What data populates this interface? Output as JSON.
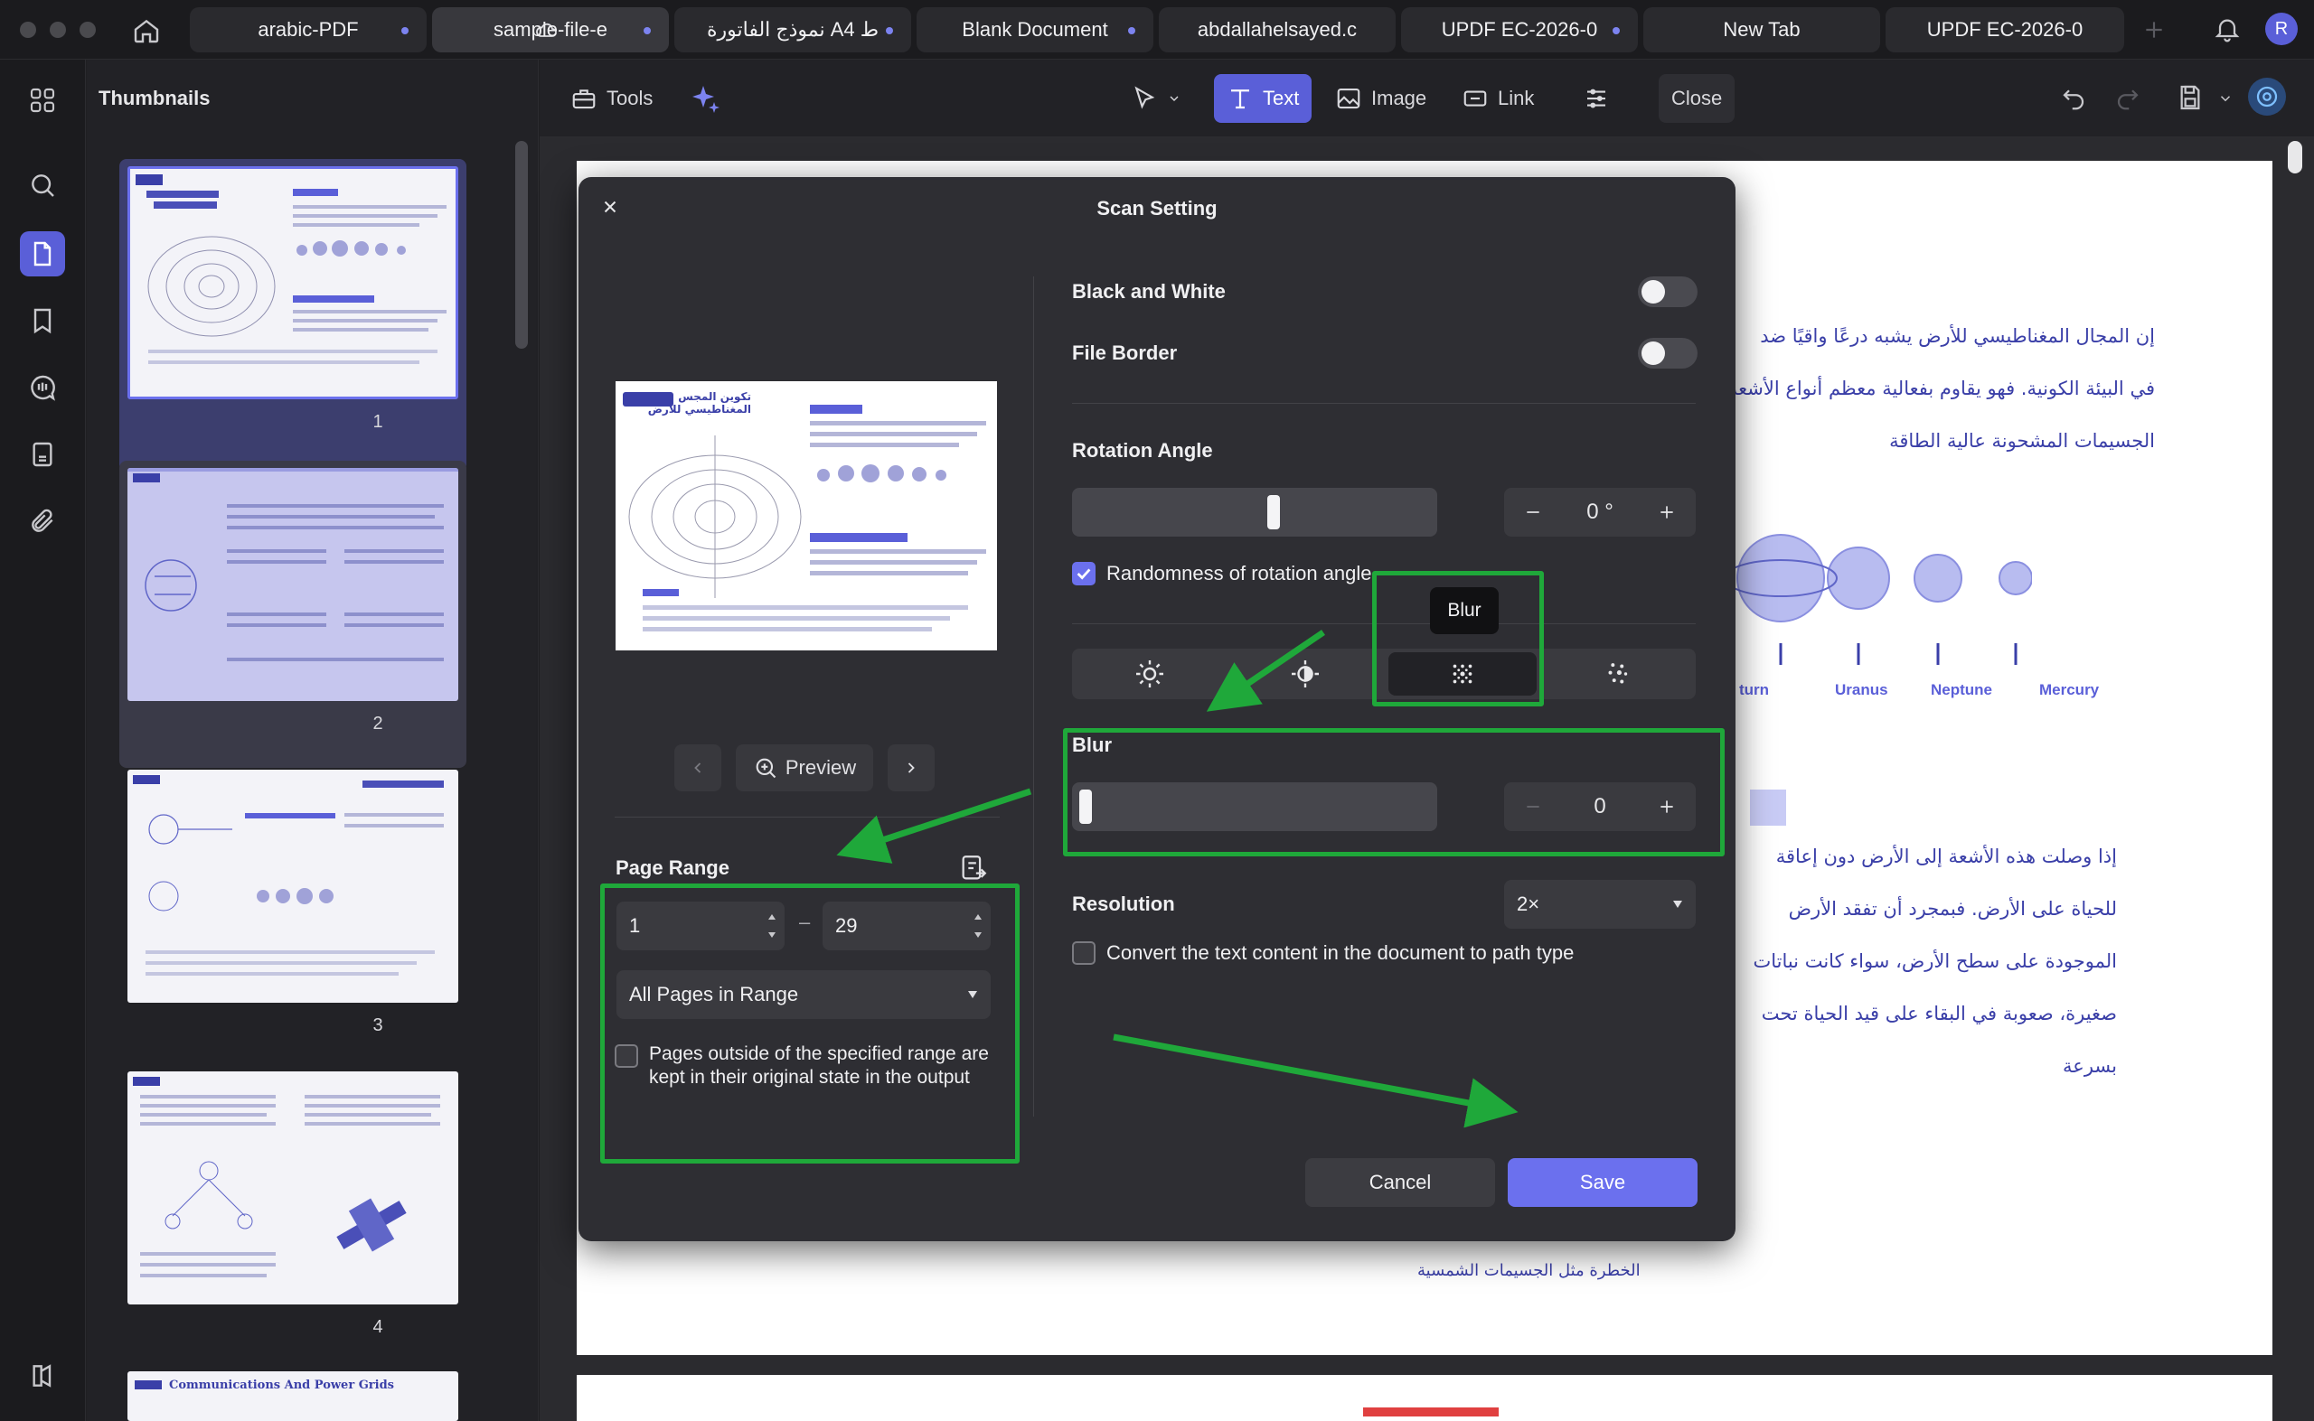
{
  "window": {
    "tabs": [
      {
        "label": "arabic-PDF",
        "active": false
      },
      {
        "label": "sample-file-e",
        "active": true
      },
      {
        "label": "نموذج الفاتورة A4 ط",
        "active": false
      },
      {
        "label": "Blank Document",
        "active": false
      },
      {
        "label": "abdallahelsayed.c",
        "active": false
      },
      {
        "label": "UPDF EC-2026-0",
        "active": false
      },
      {
        "label": "New Tab",
        "active": false
      },
      {
        "label": "UPDF EC-2026-0",
        "active": false
      }
    ],
    "avatar_letter": "R"
  },
  "sidebar": {
    "title": "Thumbnails",
    "pages": [
      "1",
      "2",
      "3",
      "4"
    ],
    "page5_heading": "Communications And Power Grids"
  },
  "toolbar": {
    "tools_label": "Tools",
    "text_label": "Text",
    "image_label": "Image",
    "link_label": "Link",
    "close_label": "Close"
  },
  "document": {
    "lines": [
      "إن المجال المغناطيسي للأرض يشبه درعًا واقيًا ضد",
      "في البيئة الكونية. فهو يقاوم بفعالية معظم أنواع الأشعة",
      "الجسيمات المشحونة عالية الطاقة",
      "إذا وصلت هذه الأشعة إلى الأرض دون إعاقة",
      "للحياة على الأرض. فبمجرد أن تفقد الأرض",
      "الموجودة على سطح الأرض، سواء كانت نباتات",
      "صغيرة، صعوبة في البقاء على قيد الحياة تحت",
      "بسرعة",
      "الخطرة مثل الجسيمات الشمسية"
    ],
    "planet_labels": [
      "turn",
      "Uranus",
      "Neptune",
      "Mercury"
    ]
  },
  "dialog": {
    "title": "Scan Setting",
    "black_and_white_label": "Black and White",
    "black_and_white_on": false,
    "file_border_label": "File Border",
    "file_border_on": false,
    "rotation_label": "Rotation Angle",
    "rotation_value": "0 °",
    "randomness_label": "Randomness of rotation angle",
    "randomness_checked": true,
    "tooltip": "Blur",
    "effects": [
      "brightness-icon",
      "contrast-icon",
      "blur-icon",
      "noise-icon"
    ],
    "selected_effect": "blur-icon",
    "blur_label": "Blur",
    "blur_value": "0",
    "resolution_label": "Resolution",
    "resolution_value": "2×",
    "convert_label": "Convert the text content in the document to path type",
    "convert_checked": false,
    "preview_label": "Preview",
    "page_range_label": "Page Range",
    "range_from": "1",
    "range_to": "29",
    "range_separator": "–",
    "range_mode": "All Pages in Range",
    "outside_pages_label": "Pages outside of the specified range are kept in their original state in the output",
    "outside_pages_checked": false,
    "cancel_label": "Cancel",
    "save_label": "Save",
    "preview_heading_ar": "تكوين المجس المغناطيسي للأرض"
  },
  "colors": {
    "accent": "#5a5fd8",
    "highlight": "#1fa83a",
    "save_button": "#6b70ee"
  }
}
